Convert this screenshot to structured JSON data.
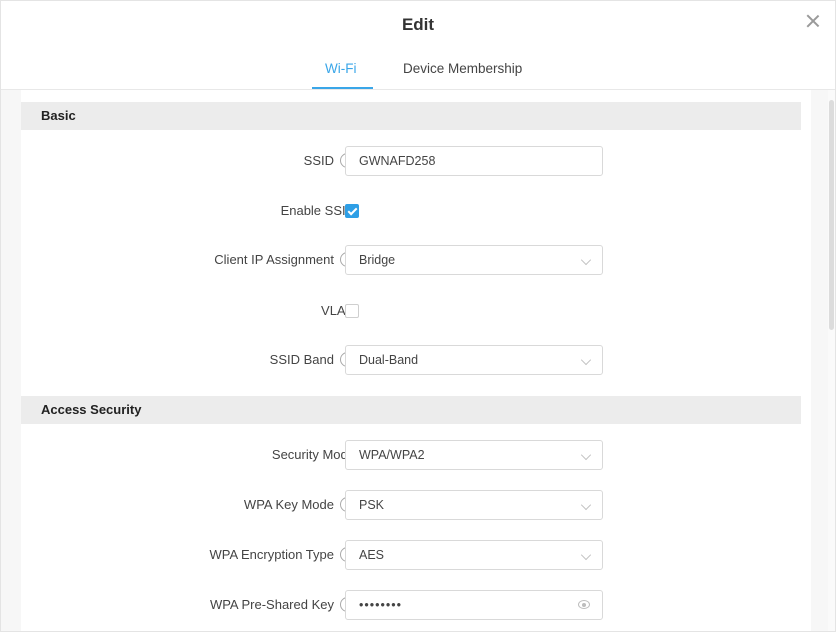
{
  "dialog": {
    "title": "Edit"
  },
  "tabs": [
    {
      "label": "Wi-Fi",
      "active": true
    },
    {
      "label": "Device Membership",
      "active": false
    }
  ],
  "sections": {
    "basic": {
      "title": "Basic"
    },
    "access_security": {
      "title": "Access Security"
    }
  },
  "help_glyph": "?",
  "fields": {
    "ssid": {
      "label": "SSID",
      "value": "GWNAFD258"
    },
    "enable_ssid": {
      "label": "Enable SSID",
      "checked": true
    },
    "client_ip_assignment": {
      "label": "Client IP Assignment",
      "value": "Bridge"
    },
    "vlan": {
      "label": "VLAN",
      "checked": false
    },
    "ssid_band": {
      "label": "SSID Band",
      "value": "Dual-Band"
    },
    "security_mode": {
      "label": "Security Mode",
      "value": "WPA/WPA2"
    },
    "wpa_key_mode": {
      "label": "WPA Key Mode",
      "value": "PSK"
    },
    "wpa_encryption_type": {
      "label": "WPA Encryption Type",
      "value": "AES"
    },
    "wpa_pre_shared_key": {
      "label": "WPA Pre-Shared Key",
      "value": "••••••••"
    }
  },
  "colors": {
    "accent": "#3aa6e8",
    "checkbox_checked": "#2e9fe6",
    "section_bg": "#ececec"
  },
  "icons": [
    "close-icon",
    "help-icon",
    "chevron-down-icon",
    "eye-icon",
    "check-icon"
  ]
}
